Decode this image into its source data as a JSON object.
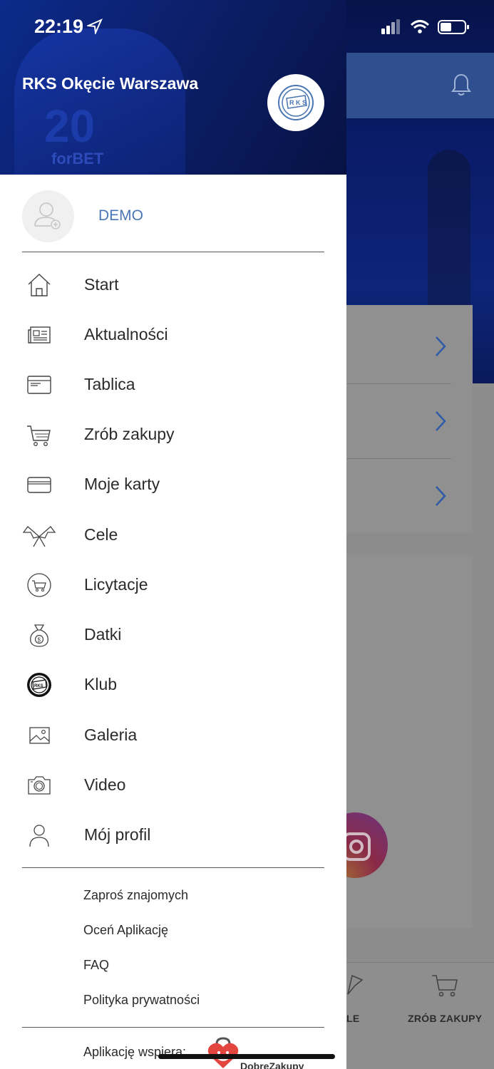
{
  "status_bar": {
    "time": "22:19"
  },
  "drawer": {
    "club_name": "RKS Okęcie Warszawa",
    "user": {
      "name": "DEMO"
    },
    "menu": [
      {
        "label": "Start",
        "icon": "home-icon"
      },
      {
        "label": "Aktualności",
        "icon": "newspaper-icon"
      },
      {
        "label": "Tablica",
        "icon": "board-icon"
      },
      {
        "label": "Zrób zakupy",
        "icon": "cart-icon"
      },
      {
        "label": "Moje karty",
        "icon": "card-icon"
      },
      {
        "label": "Cele",
        "icon": "flags-icon"
      },
      {
        "label": "Licytacje",
        "icon": "auction-cart-icon"
      },
      {
        "label": "Datki",
        "icon": "money-bag-icon"
      },
      {
        "label": "Klub",
        "icon": "club-crest-icon"
      },
      {
        "label": "Galeria",
        "icon": "image-icon"
      },
      {
        "label": "Video",
        "icon": "camera-icon"
      },
      {
        "label": "Mój profil",
        "icon": "person-icon"
      }
    ],
    "links": [
      {
        "label": "Zaproś znajomych"
      },
      {
        "label": "Oceń Aplikację"
      },
      {
        "label": "FAQ"
      },
      {
        "label": "Polityka prywatności"
      }
    ],
    "supported_by": "Aplikację wspiera:",
    "sponsor": "DobreZakupy"
  },
  "background": {
    "tabbar": {
      "left_label": "LE",
      "right_label": "ZRÓB ZAKUPY"
    }
  }
}
